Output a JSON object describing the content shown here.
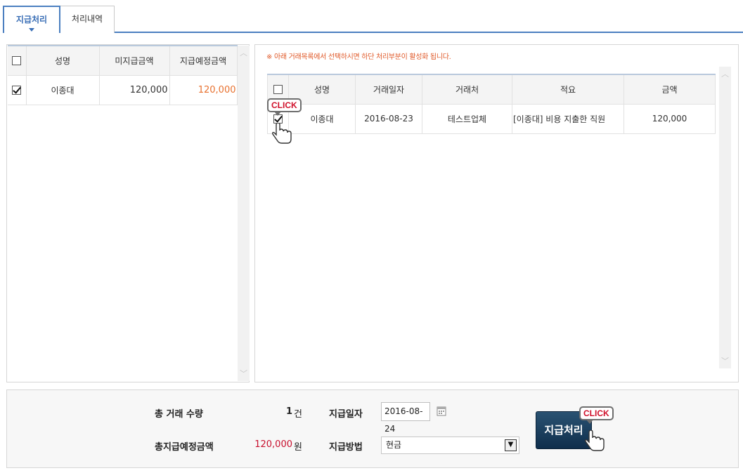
{
  "tabs": [
    {
      "label": "지급처리",
      "active": true
    },
    {
      "label": "처리내역",
      "active": false
    }
  ],
  "left_table": {
    "headers": [
      "",
      "성명",
      "미지급금액",
      "지급예정금액"
    ],
    "rows": [
      {
        "checked": true,
        "name": "이종대",
        "unpaid": "120,000",
        "scheduled": "120,000"
      }
    ]
  },
  "right_panel": {
    "notice": "※ 아래 거래목록에서 선택하시면 하단 처리부분이 활성화 됩니다.",
    "headers": [
      "",
      "성명",
      "거래일자",
      "거래처",
      "적요",
      "금액"
    ],
    "rows": [
      {
        "checked": true,
        "name": "이종대",
        "date": "2016-08-23",
        "vendor": "테스트업체",
        "memo": "[이종대] 비용 지출한 직원",
        "amount": "120,000"
      }
    ],
    "click_label": "CLICK"
  },
  "bottom": {
    "total_count_label": "총 거래 수량",
    "total_count_value": "1",
    "total_count_unit": "건",
    "total_amount_label": "총지급예정금액",
    "total_amount_value": "120,000",
    "total_amount_unit": "원",
    "pay_date_label": "지급일자",
    "pay_date_value": "2016-08-24",
    "pay_method_label": "지급방법",
    "pay_method_value": "현금",
    "pay_button": "지급처리",
    "click_label": "CLICK"
  },
  "colors": {
    "accent": "#4b7fc0",
    "highlight_amount": "#e8712f",
    "total_amount": "#c8102e",
    "button": "#1b3d5e"
  },
  "icons": [
    "calendar-icon",
    "chevron-up-icon",
    "chevron-down-icon",
    "pointer-hand-icon",
    "dropdown-arrow-icon"
  ]
}
